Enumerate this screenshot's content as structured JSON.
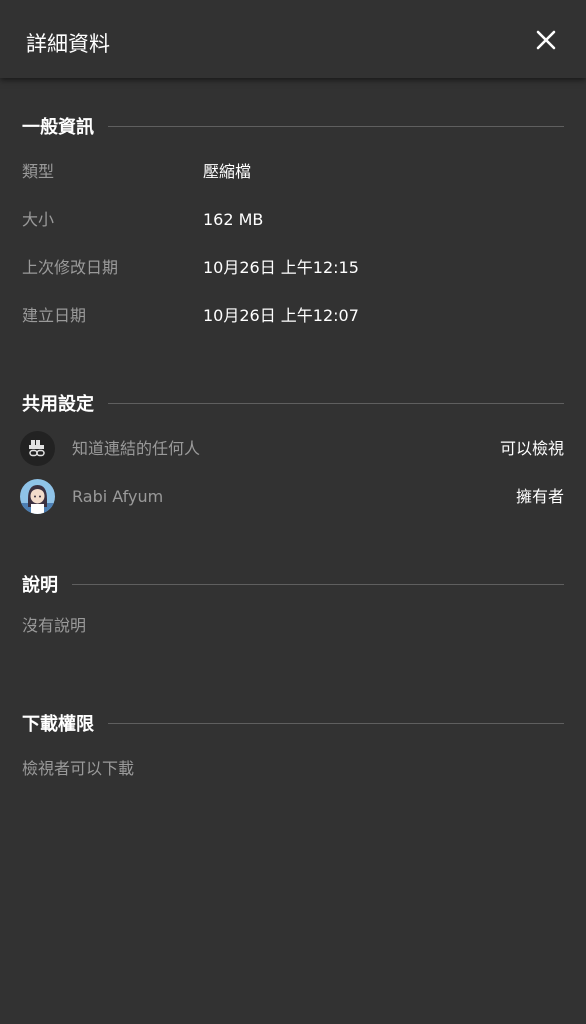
{
  "header": {
    "title": "詳細資料",
    "close_icon": "close-icon"
  },
  "general": {
    "heading": "一般資訊",
    "rows": [
      {
        "key": "類型",
        "value": "壓縮檔"
      },
      {
        "key": "大小",
        "value": "162 MB"
      },
      {
        "key": "上次修改日期",
        "value": "10月26日 上午12:15"
      },
      {
        "key": "建立日期",
        "value": "10月26日 上午12:07"
      }
    ]
  },
  "sharing": {
    "heading": "共用設定",
    "entries": [
      {
        "name": "知道連結的任何人",
        "permission": "可以檢視",
        "icon": "link-people-icon"
      },
      {
        "name": "Rabi Afyum",
        "permission": "擁有者",
        "icon": "avatar"
      }
    ]
  },
  "description": {
    "heading": "說明",
    "text": "沒有說明"
  },
  "download": {
    "heading": "下載權限",
    "text": "檢視者可以下載"
  },
  "colors": {
    "background": "#323232",
    "text": "#ffffff",
    "secondary_text": "#9a9a9a",
    "rule": "#5f5f5f"
  }
}
